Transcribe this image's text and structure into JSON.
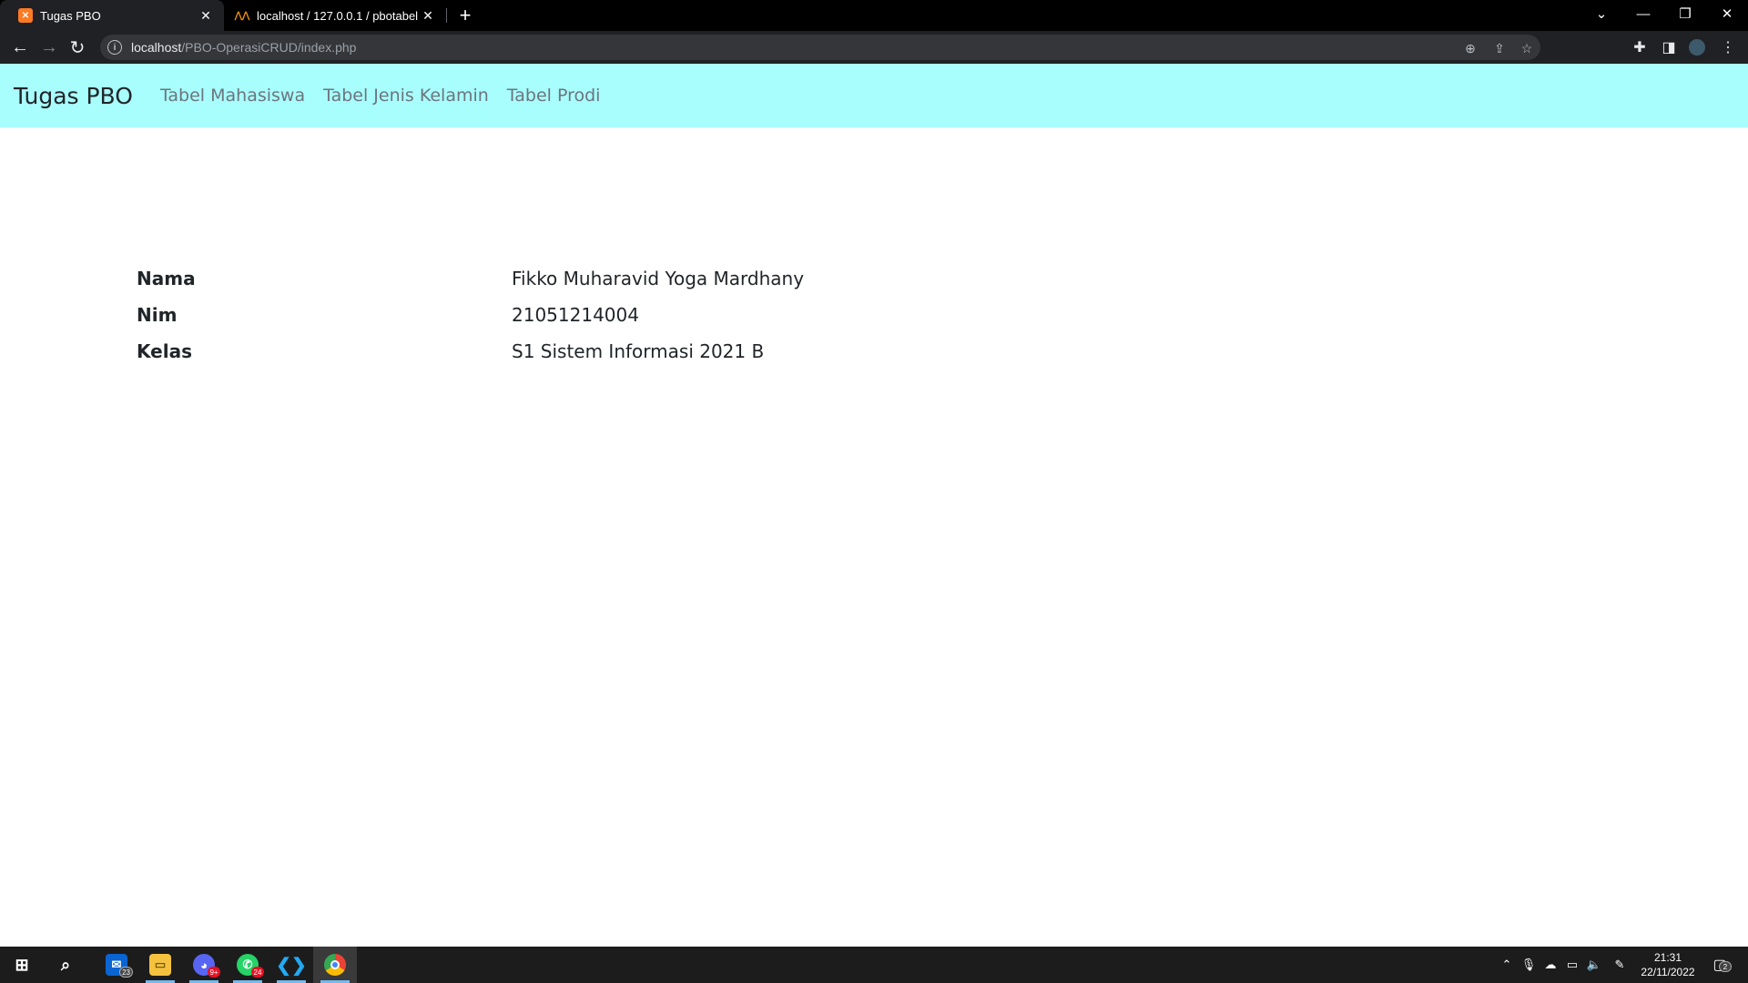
{
  "browser": {
    "tabs": [
      {
        "title": "Tugas PBO",
        "favicon": "xampp-icon",
        "active": true
      },
      {
        "title": "localhost / 127.0.0.1 / pbotabel /",
        "favicon": "phpmyadmin-icon",
        "active": false
      }
    ],
    "url_host": "localhost",
    "url_path": "/PBO-OperasiCRUD/index.php"
  },
  "navbar": {
    "brand": "Tugas PBO",
    "links": [
      "Tabel Mahasiswa",
      "Tabel Jenis Kelamin",
      "Tabel Prodi"
    ],
    "background": "#a8fdfd"
  },
  "profile": {
    "rows": [
      {
        "label": "Nama",
        "value": "Fikko Muharavid Yoga Mardhany"
      },
      {
        "label": "Nim",
        "value": "21051214004"
      },
      {
        "label": "Kelas",
        "value": "S1 Sistem Informasi 2021 B"
      }
    ]
  },
  "taskbar": {
    "apps": [
      {
        "name": "mail",
        "badge": "23"
      },
      {
        "name": "file-explorer",
        "badge": ""
      },
      {
        "name": "discord",
        "badge": "9+"
      },
      {
        "name": "whatsapp",
        "badge": "24"
      },
      {
        "name": "vscode",
        "badge": ""
      },
      {
        "name": "chrome",
        "badge": ""
      }
    ],
    "time": "21:31",
    "date": "22/11/2022",
    "notifications": "2"
  }
}
